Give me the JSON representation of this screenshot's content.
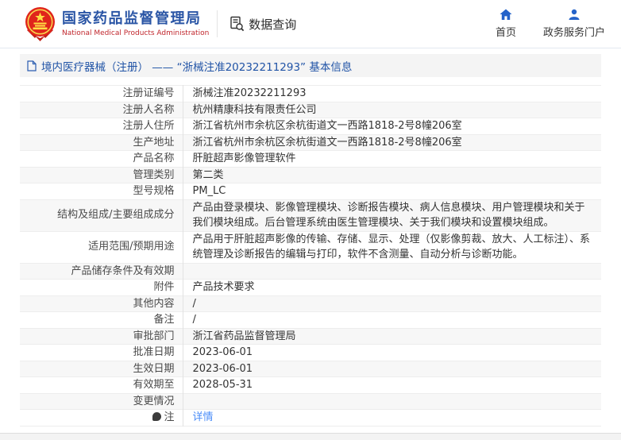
{
  "header": {
    "agency_cn": "国家药品监督管理局",
    "agency_en": "National Medical Products Administration",
    "nav_data_query": "数据查询",
    "nav_home": "首页",
    "nav_portal": "政务服务门户"
  },
  "page": {
    "section_title": "境内医疗器械（注册） ——  “浙械注准20232211293”  基本信息"
  },
  "table": {
    "rows": [
      {
        "label": "注册证编号",
        "value": "浙械注准20232211293"
      },
      {
        "label": "注册人名称",
        "value": "杭州精康科技有限责任公司"
      },
      {
        "label": "注册人住所",
        "value": "浙江省杭州市余杭区余杭街道文一西路1818-2号8幢206室"
      },
      {
        "label": "生产地址",
        "value": "浙江省杭州市余杭区余杭街道文一西路1818-2号8幢206室"
      },
      {
        "label": "产品名称",
        "value": "肝脏超声影像管理软件"
      },
      {
        "label": "管理类别",
        "value": "第二类"
      },
      {
        "label": "型号规格",
        "value": "PM_LC"
      },
      {
        "label": "结构及组成/主要组成成分",
        "value": "产品由登录模块、影像管理模块、诊断报告模块、病人信息模块、用户管理模块和关于我们模块组成。后台管理系统由医生管理模块、关于我们模块和设置模块组成。"
      },
      {
        "label": "适用范围/预期用途",
        "value": "产品用于肝脏超声影像的传输、存储、显示、处理（仅影像剪裁、放大、人工标注）、系统管理及诊断报告的编辑与打印，软件不含测量、自动分析与诊断功能。"
      },
      {
        "label": "产品储存条件及有效期",
        "value": ""
      },
      {
        "label": "附件",
        "value": "产品技术要求"
      },
      {
        "label": "其他内容",
        "value": "/"
      },
      {
        "label": "备注",
        "value": "/"
      },
      {
        "label": "审批部门",
        "value": "浙江省药品监督管理局"
      },
      {
        "label": "批准日期",
        "value": "2023-06-01"
      },
      {
        "label": "生效日期",
        "value": "2023-06-01"
      },
      {
        "label": "有效期至",
        "value": "2028-05-31"
      },
      {
        "label": "变更情况",
        "value": ""
      },
      {
        "label": "注",
        "value": "详情",
        "icon": "comment",
        "link": true
      }
    ]
  },
  "colors": {
    "brand_blue": "#2a55a5",
    "brand_red": "#c1272d",
    "emblem_red": "#e0251b",
    "emblem_gold": "#ffde45",
    "title_blue": "#2053a6",
    "link_blue": "#4b8df8",
    "icon_blue": "#2563c9",
    "row_shade": "#f7f7f7"
  }
}
